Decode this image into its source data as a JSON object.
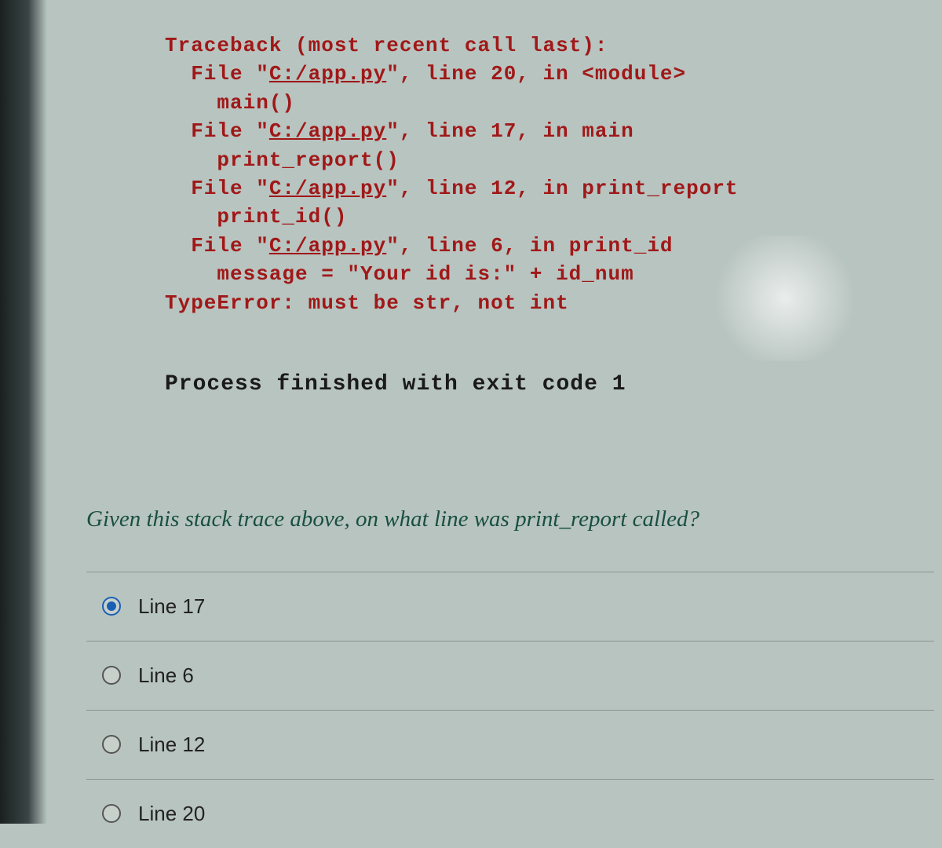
{
  "traceback": {
    "header": "Traceback (most recent call last):",
    "frames": [
      {
        "file_prefix": "  File \"",
        "path": "C:/app.py",
        "file_suffix": "\", line 20, in <module>",
        "code": "    main()"
      },
      {
        "file_prefix": "  File \"",
        "path": "C:/app.py",
        "file_suffix": "\", line 17, in main",
        "code": "    print_report()"
      },
      {
        "file_prefix": "  File \"",
        "path": "C:/app.py",
        "file_suffix": "\", line 12, in print_report",
        "code": "    print_id()"
      },
      {
        "file_prefix": "  File \"",
        "path": "C:/app.py",
        "file_suffix": "\", line 6, in print_id",
        "code": "    message = \"Your id is:\" + id_num"
      }
    ],
    "error": "TypeError: must be str, not int"
  },
  "process_line": "Process finished with exit code 1",
  "question": "Given this stack trace above, on what line was print_report called?",
  "options": [
    {
      "label": "Line 17",
      "selected": true
    },
    {
      "label": "Line 6",
      "selected": false
    },
    {
      "label": "Line 12",
      "selected": false
    },
    {
      "label": "Line 20",
      "selected": false
    }
  ]
}
